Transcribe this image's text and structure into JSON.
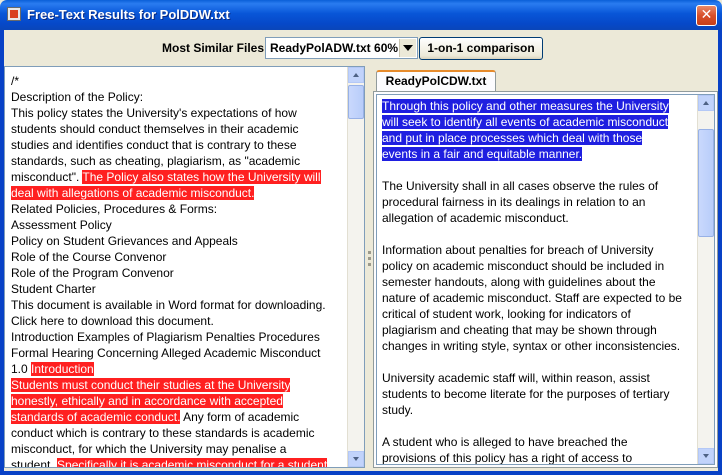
{
  "window": {
    "title": "Free-Text Results for PolDDW.txt",
    "close_glyph": "✕"
  },
  "toolbar": {
    "most_similar_label": "Most Similar Files:",
    "selected_file": "ReadyPolADW.txt 60%",
    "compare_button": "1-on-1 comparison"
  },
  "left_document": {
    "lines": [
      [
        {
          "text": "/*",
          "hl": ""
        }
      ],
      [
        {
          "text": "Description of the Policy:",
          "hl": ""
        }
      ],
      [
        {
          "text": "This policy states the University's expectations of how",
          "hl": ""
        }
      ],
      [
        {
          "text": "students should conduct themselves in their academic",
          "hl": ""
        }
      ],
      [
        {
          "text": "studies and identifies conduct that is contrary to these",
          "hl": ""
        }
      ],
      [
        {
          "text": "standards, such as cheating, plagiarism, as \"academic",
          "hl": ""
        }
      ],
      [
        {
          "text": "misconduct\". ",
          "hl": ""
        },
        {
          "text": "The Policy also states how the University will",
          "hl": "red"
        }
      ],
      [
        {
          "text": "deal with allegations of academic misconduct.",
          "hl": "red"
        }
      ],
      [
        {
          "text": "Related Policies, Procedures & Forms:",
          "hl": ""
        }
      ],
      [
        {
          "text": "Assessment Policy",
          "hl": ""
        }
      ],
      [
        {
          "text": "Policy on Student Grievances and Appeals",
          "hl": ""
        }
      ],
      [
        {
          "text": "Role of the Course Convenor",
          "hl": ""
        }
      ],
      [
        {
          "text": "Role of the Program Convenor",
          "hl": ""
        }
      ],
      [
        {
          "text": "Student Charter",
          "hl": ""
        }
      ],
      [
        {
          "text": "This document is available in Word format for downloading.",
          "hl": ""
        }
      ],
      [
        {
          "text": "Click here to download this document.",
          "hl": ""
        }
      ],
      [
        {
          "text": "Introduction Examples of Plagiarism Penalties Procedures",
          "hl": ""
        }
      ],
      [
        {
          "text": "Formal Hearing Concerning Alleged Academic Misconduct",
          "hl": ""
        }
      ],
      [
        {
          "text": "1.0 ",
          "hl": ""
        },
        {
          "text": "Introduction",
          "hl": "red"
        }
      ],
      [
        {
          "text": "Students must conduct their studies at the University",
          "hl": "red"
        }
      ],
      [
        {
          "text": "honestly, ethically and in accordance with accepted",
          "hl": "red"
        }
      ],
      [
        {
          "text": "standards of academic conduct.",
          "hl": "red"
        },
        {
          "text": " Any form of academic",
          "hl": ""
        }
      ],
      [
        {
          "text": "conduct which is contrary to these standards is academic",
          "hl": ""
        }
      ],
      [
        {
          "text": "misconduct, for which the University may penalise a",
          "hl": ""
        }
      ],
      [
        {
          "text": "student. ",
          "hl": ""
        },
        {
          "text": "Specifically it is academic misconduct for a student",
          "hl": "red"
        }
      ]
    ]
  },
  "right_tab": {
    "label": "ReadyPolCDW.txt"
  },
  "right_document": {
    "lines": [
      [
        {
          "text": "Through this policy and other measures the University",
          "hl": "blue"
        }
      ],
      [
        {
          "text": "will seek to identify all events of academic misconduct",
          "hl": "blue"
        }
      ],
      [
        {
          "text": "and put in place processes which deal with those",
          "hl": "blue"
        }
      ],
      [
        {
          "text": "events in a fair and equitable manner.",
          "hl": "blue"
        }
      ],
      [
        {
          "text": "",
          "hl": ""
        }
      ],
      [
        {
          "text": "The University shall in all cases observe the rules of",
          "hl": ""
        }
      ],
      [
        {
          "text": "procedural fairness in its dealings in relation to an",
          "hl": ""
        }
      ],
      [
        {
          "text": "allegation of academic misconduct.",
          "hl": ""
        }
      ],
      [
        {
          "text": "",
          "hl": ""
        }
      ],
      [
        {
          "text": "Information about penalties for breach of University",
          "hl": ""
        }
      ],
      [
        {
          "text": "policy on academic misconduct should be included in",
          "hl": ""
        }
      ],
      [
        {
          "text": "semester handouts, along with guidelines about the",
          "hl": ""
        }
      ],
      [
        {
          "text": "nature of academic misconduct. Staff are expected to be",
          "hl": ""
        }
      ],
      [
        {
          "text": "critical of student work, looking for indicators of",
          "hl": ""
        }
      ],
      [
        {
          "text": "plagiarism and cheating that may be shown through",
          "hl": ""
        }
      ],
      [
        {
          "text": "changes in writing style, syntax or other inconsistencies.",
          "hl": ""
        }
      ],
      [
        {
          "text": "",
          "hl": ""
        }
      ],
      [
        {
          "text": "University academic staff will, within reason, assist",
          "hl": ""
        }
      ],
      [
        {
          "text": "students to become literate for the purposes of tertiary",
          "hl": ""
        }
      ],
      [
        {
          "text": "study.",
          "hl": ""
        }
      ],
      [
        {
          "text": "",
          "hl": ""
        }
      ],
      [
        {
          "text": "A student who is alleged to have breached the",
          "hl": ""
        }
      ],
      [
        {
          "text": "provisions of this policy has a right of access to",
          "hl": ""
        }
      ]
    ]
  },
  "colors": {
    "highlight_red": "#ff2020",
    "highlight_blue": "#1f1fe0",
    "title_bar": "#0856d8"
  }
}
